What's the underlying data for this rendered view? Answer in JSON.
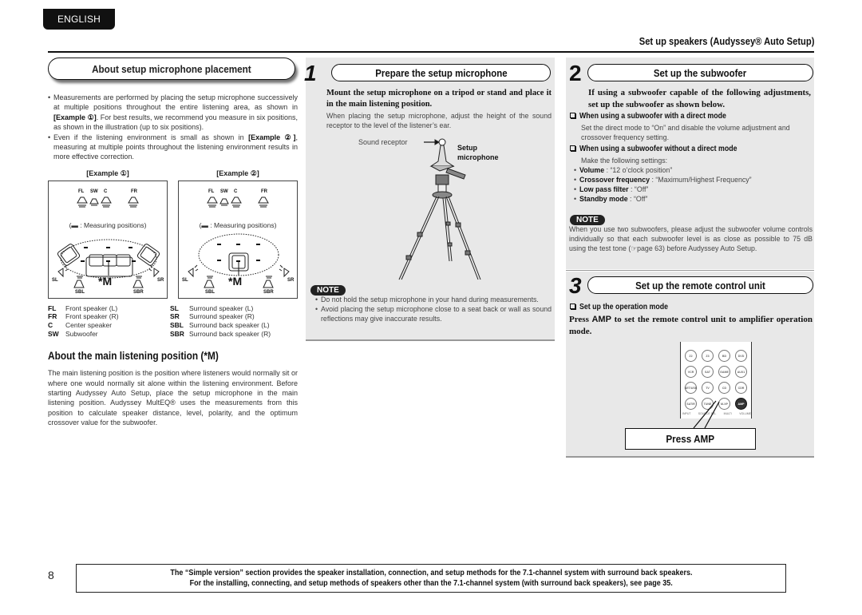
{
  "page": {
    "language_tab": "ENGLISH",
    "header_title": "Set up speakers (Audyssey® Auto Setup)",
    "page_number": "8"
  },
  "col1": {
    "title": "About setup microphone placement",
    "bullets": [
      {
        "pre": "Measurements are performed by placing the setup microphone successively at multiple positions throughout the entire listening area, as shown in ",
        "bold": "[Example ①]",
        "post": ". For best results, we recommend you measure in six positions, as shown in the illustration (up to six positions)."
      },
      {
        "pre": "Even if the listening environment is small as shown in ",
        "bold": "[Example ②]",
        "post": ", measuring at multiple points throughout the listening environment results in more effective correction."
      }
    ],
    "examples": [
      {
        "label": "[Example ①]",
        "measuring": "(▬ : Measuring positions)",
        "main": "*M"
      },
      {
        "label": "[Example ②]",
        "measuring": "(▬ : Measuring positions)",
        "main": "*M"
      }
    ],
    "speaker_tags": {
      "FL": "FL",
      "SW": "SW",
      "C": "C",
      "FR": "FR",
      "SL": "SL",
      "SR": "SR",
      "SBL": "SBL",
      "SBR": "SBR"
    },
    "legend_left": [
      {
        "code": "FL",
        "desc": "Front speaker (L)"
      },
      {
        "code": "FR",
        "desc": "Front speaker (R)"
      },
      {
        "code": "C",
        "desc": "Center speaker"
      },
      {
        "code": "SW",
        "desc": "Subwoofer"
      }
    ],
    "legend_right": [
      {
        "code": "SL",
        "desc": "Surround speaker (L)"
      },
      {
        "code": "SR",
        "desc": "Surround speaker (R)"
      },
      {
        "code": "SBL",
        "desc": "Surround back speaker (L)"
      },
      {
        "code": "SBR",
        "desc": "Surround back speaker (R)"
      }
    ],
    "main_position_title": "About the main listening position (*M)",
    "main_position_text": "The main listening position is the position where listeners would normally sit or where one would normally sit alone within the listening environment. Before starting Audyssey Auto Setup, place the setup microphone in the main listening position. Audyssey MultEQ® uses the measurements from this position to calculate speaker distance, level, polarity, and the optimum crossover value for the subwoofer."
  },
  "step1": {
    "number": "1",
    "title": "Prepare the setup microphone",
    "instruction": "Mount the setup microphone on a tripod or stand and place it in the main listening position.",
    "detail": "When placing the setup microphone, adjust the height of the sound receptor to the level of the listener’s ear.",
    "label_receptor": "Sound receptor",
    "label_mic_1": "Setup",
    "label_mic_2": "microphone",
    "note_label": "NOTE",
    "notes": [
      "Do not hold the setup microphone in your hand during measurements.",
      "Avoid placing the setup microphone close to a seat back or wall as sound reflections may give inaccurate results."
    ]
  },
  "step2": {
    "number": "2",
    "title": "Set up the subwoofer",
    "instruction": "If using a subwoofer capable of the following adjustments, set up the subwoofer as shown below.",
    "direct_head": "When using a subwoofer with a direct mode",
    "direct_text": "Set the direct mode to “On” and disable the volume adjustment and crossover frequency setting.",
    "nodirect_head": "When using a subwoofer without a direct mode",
    "nodirect_intro": "Make the following settings:",
    "settings": [
      {
        "name": "Volume",
        "value": " : “12 o’clock position”"
      },
      {
        "name": "Crossover frequency",
        "value": " : “Maximum/Highest Frequency”"
      },
      {
        "name": "Low pass filter",
        "value": " : “Off”"
      },
      {
        "name": "Standby mode",
        "value": " : “Off”"
      }
    ],
    "note_label": "NOTE",
    "note_text": "When you use two subwoofers, please adjust the subwoofer volume controls individually so that each subwoofer level is as close as possible to 75 dB using the test tone (☞page 63) before Audyssey Auto Setup."
  },
  "step3": {
    "number": "3",
    "title": "Set up the remote control unit",
    "op_head": "Set up the operation mode",
    "op_pre": "Press ",
    "op_key": "AMP",
    "op_post": " to set the remote control unit to amplifier operation mode.",
    "remote_buttons": [
      [
        "Z2",
        "Z3",
        "BD",
        "DVD"
      ],
      [
        "VCR",
        "SAT",
        "GAME",
        "AUX1"
      ],
      [
        "NET/USB",
        "TV",
        "CD",
        "CDR"
      ],
      [
        "SAT/R",
        "TUNE",
        "M-XP",
        "AMP"
      ]
    ],
    "remote_bottom_labels": [
      "INPUT",
      "SOURCE SEL",
      "MULTI",
      "VOLUME"
    ],
    "callout": "Press AMP"
  },
  "footer": {
    "line1": "The “Simple version” section provides the speaker installation, connection, and setup methods for the 7.1-channel system with surround back speakers.",
    "line2": "For the installing, connecting, and setup methods of speakers other than the 7.1-channel system (with surround back speakers), see page 35."
  }
}
